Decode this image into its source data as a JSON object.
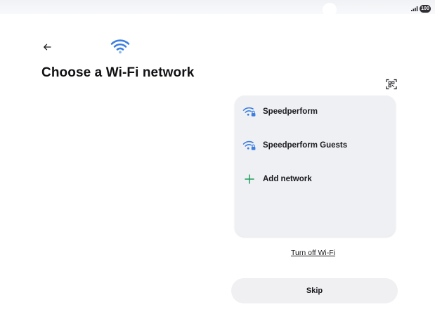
{
  "status_bar": {
    "battery_level": "100",
    "icons": [
      "signal-bars-icon",
      "battery-icon"
    ]
  },
  "header": {
    "back_icon": "arrow-left-icon",
    "wifi_icon": "wifi-icon",
    "title": "Choose a Wi-Fi network",
    "qr_icon": "qr-code-scan-icon"
  },
  "networks": {
    "items": [
      {
        "label": "Speedperform",
        "icon": "wifi-locked-icon"
      },
      {
        "label": "Speedperform Guests",
        "icon": "wifi-locked-icon"
      },
      {
        "label": "Add network",
        "icon": "plus-icon"
      }
    ]
  },
  "actions": {
    "turn_off_label": "Turn off Wi-Fi",
    "skip_label": "Skip"
  },
  "colors": {
    "wifi_accent": "#3d7ee0",
    "add_accent": "#1f9e5a",
    "panel_bg": "#eff0f4",
    "button_bg": "#f0f0f3"
  }
}
